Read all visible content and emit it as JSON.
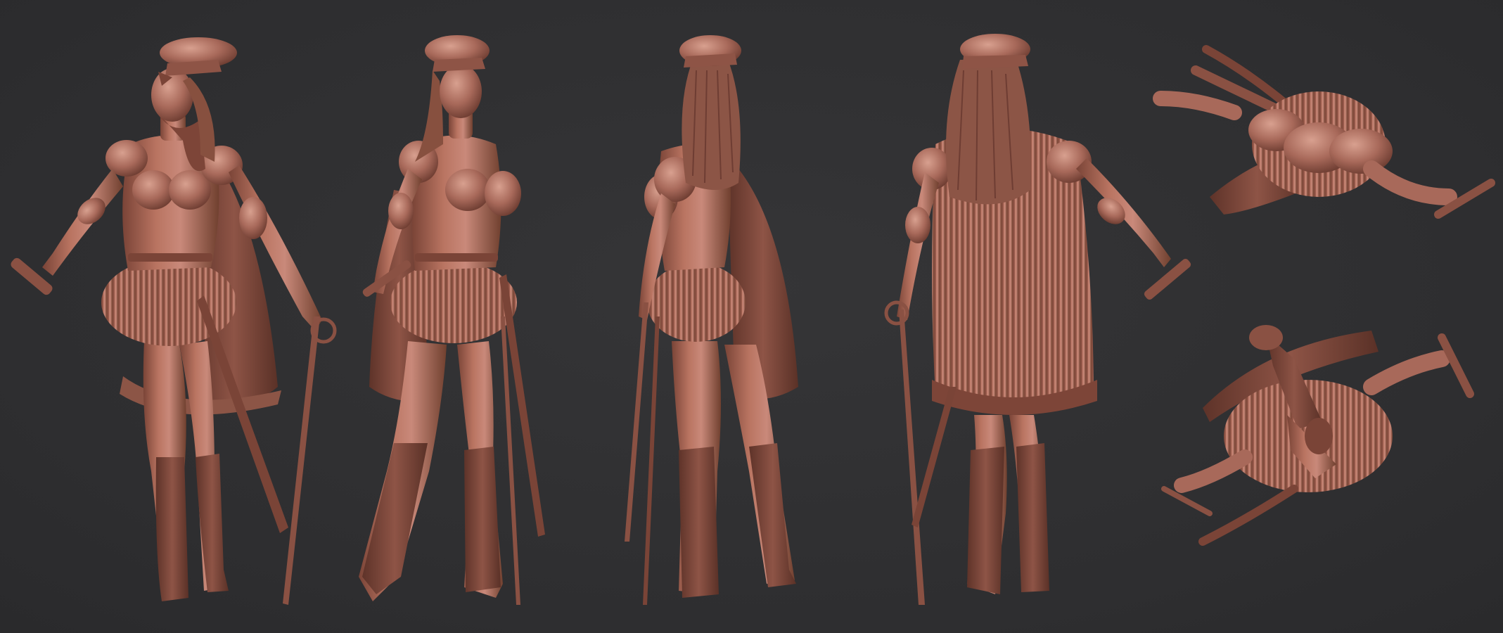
{
  "scene": {
    "background_color": "#2f2f31",
    "clay_color": "#a8695a",
    "clay_shadow": "#6e3d33",
    "clay_highlight": "#d49886",
    "views": [
      {
        "name": "front-three-quarter"
      },
      {
        "name": "front-side"
      },
      {
        "name": "back-side"
      },
      {
        "name": "back"
      },
      {
        "name": "top-down"
      },
      {
        "name": "bottom-up"
      }
    ]
  }
}
